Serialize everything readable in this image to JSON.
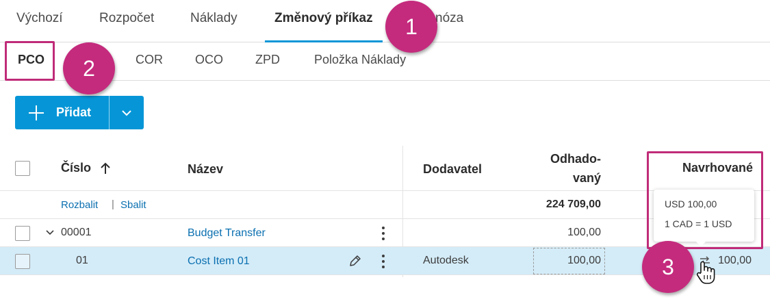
{
  "top_tabs": [
    {
      "label": "Výchozí",
      "active": false
    },
    {
      "label": "Rozpočet",
      "active": false
    },
    {
      "label": "Náklady",
      "active": false
    },
    {
      "label": "Změnový příkaz",
      "active": true
    },
    {
      "label": "nóza",
      "active": false
    }
  ],
  "sub_tabs": [
    {
      "label": "PCO",
      "active": true
    },
    {
      "label": "COR",
      "active": false
    },
    {
      "label": "OCO",
      "active": false
    },
    {
      "label": "ZPD",
      "active": false
    },
    {
      "label": "Položka Náklady",
      "active": false
    }
  ],
  "toolbar": {
    "add_label": "Přidat"
  },
  "table": {
    "headers": {
      "number": "Číslo",
      "name": "Název",
      "supplier": "Dodavatel",
      "estimated_line1": "Odhado-",
      "estimated_line2": "vaný",
      "proposed": "Navrhované"
    },
    "expand_label": "Rozbalit",
    "separator": "|",
    "collapse_label": "Sbalit",
    "estimated_total": "224 709,00",
    "rows": [
      {
        "number": "00001",
        "name": "Budget Transfer",
        "supplier": "",
        "estimated": "100,00",
        "proposed": ""
      },
      {
        "number": "01",
        "name": "Cost Item 01",
        "supplier": "Autodesk",
        "estimated": "100,00",
        "proposed": "100,00"
      }
    ]
  },
  "tooltip": {
    "line1": "USD 100,00",
    "line2": "1 CAD = 1 USD"
  },
  "annotations": {
    "badge1": "1",
    "badge2": "2",
    "badge3": "3"
  },
  "colors": {
    "accent": "#0696d7",
    "annotation": "#c42b7d",
    "selected_row": "#d4ecf8",
    "link": "#0a6fb0"
  }
}
